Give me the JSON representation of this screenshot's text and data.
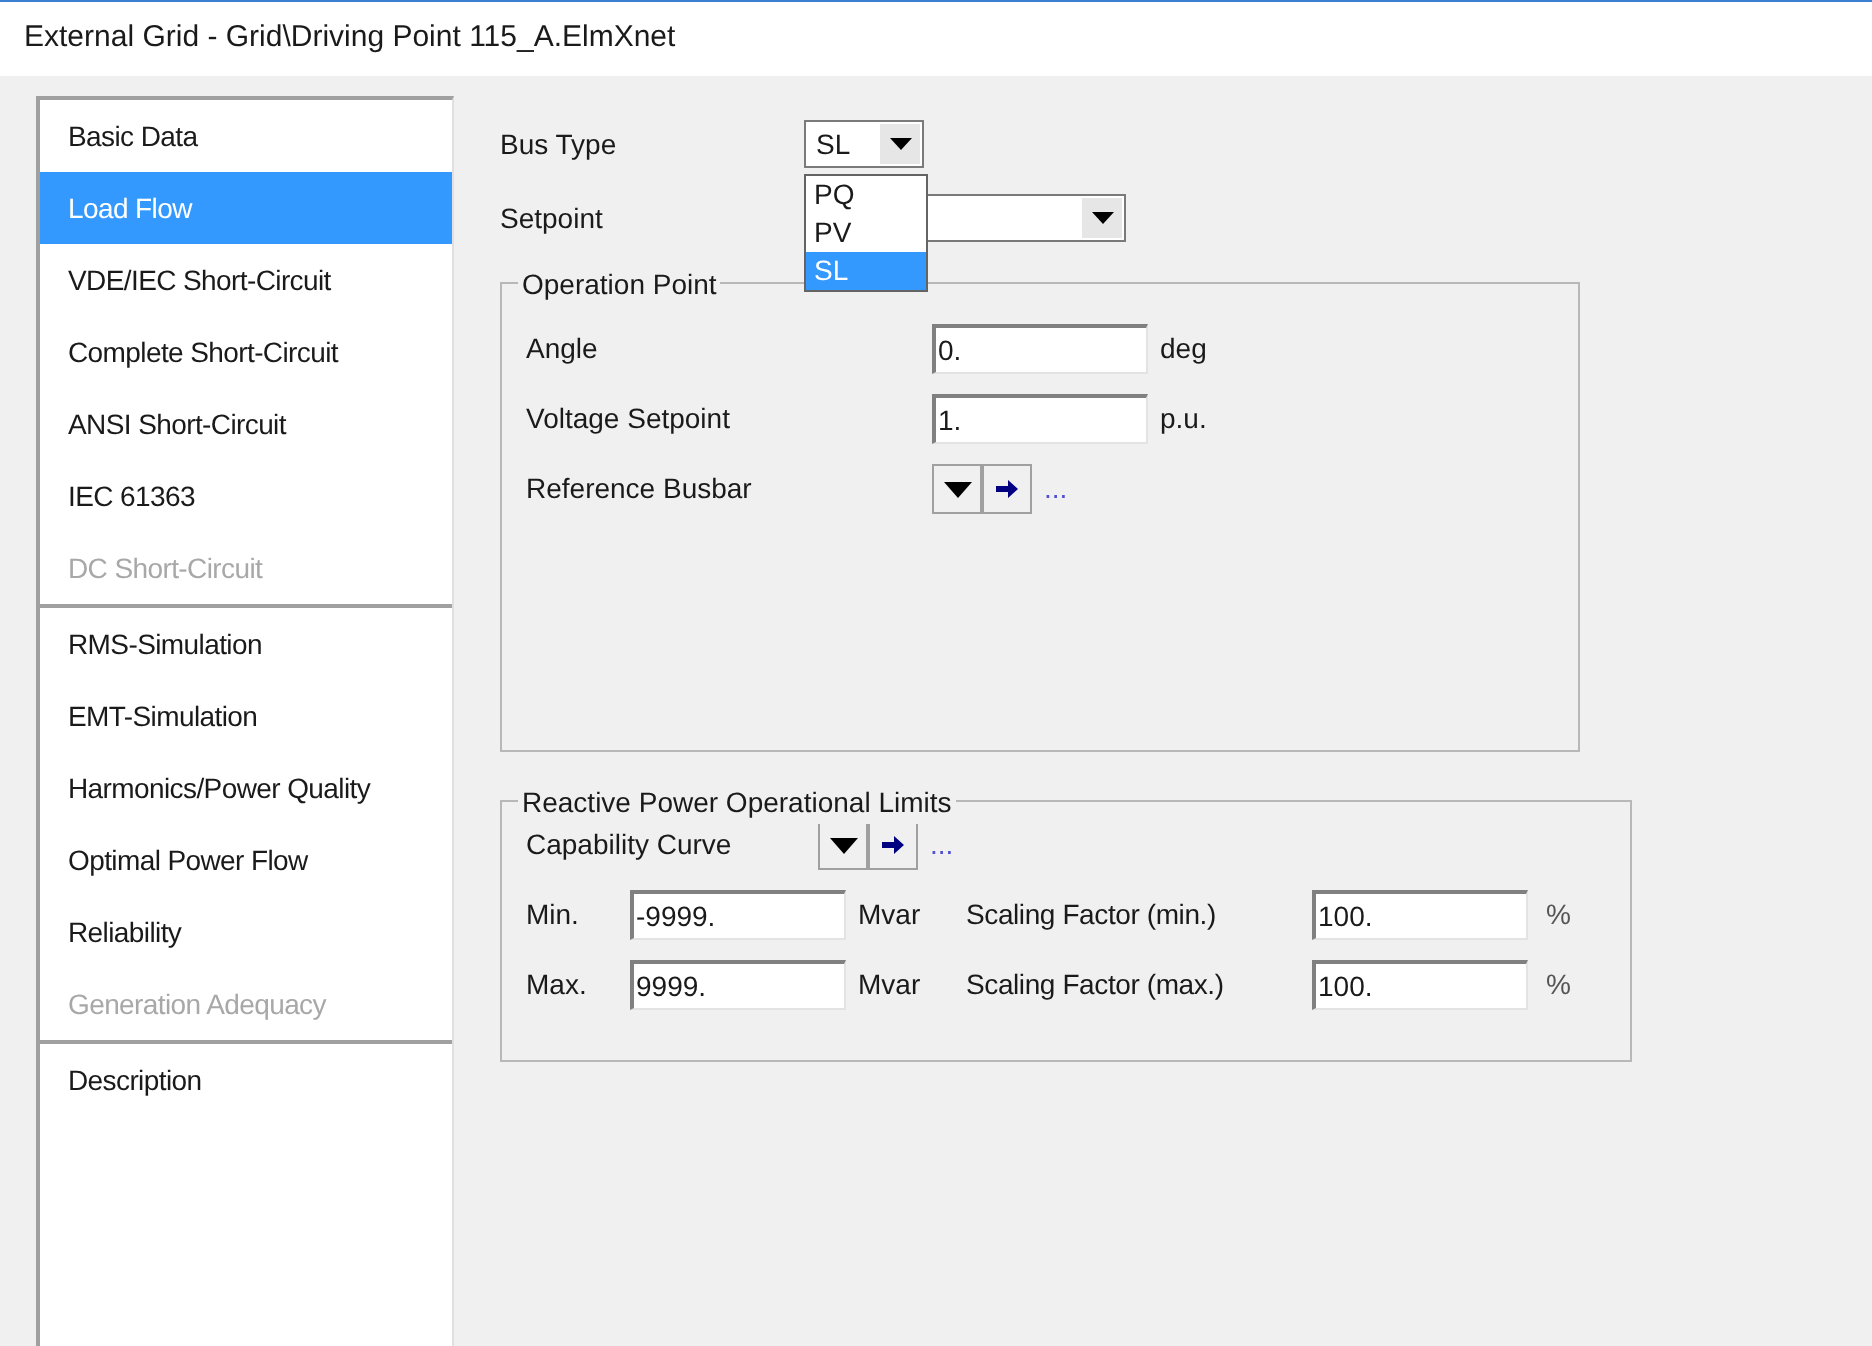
{
  "window": {
    "title": "External Grid - Grid\\Driving Point 115_A.ElmXnet"
  },
  "sidebar": {
    "groups": [
      {
        "items": [
          {
            "label": "Basic Data",
            "selected": false,
            "disabled": false
          },
          {
            "label": "Load Flow",
            "selected": true,
            "disabled": false
          },
          {
            "label": "VDE/IEC Short-Circuit",
            "selected": false,
            "disabled": false
          },
          {
            "label": "Complete Short-Circuit",
            "selected": false,
            "disabled": false
          },
          {
            "label": "ANSI Short-Circuit",
            "selected": false,
            "disabled": false
          },
          {
            "label": "IEC 61363",
            "selected": false,
            "disabled": false
          },
          {
            "label": "DC Short-Circuit",
            "selected": false,
            "disabled": true
          }
        ]
      },
      {
        "items": [
          {
            "label": "RMS-Simulation",
            "selected": false,
            "disabled": false
          },
          {
            "label": "EMT-Simulation",
            "selected": false,
            "disabled": false
          },
          {
            "label": "Harmonics/Power Quality",
            "selected": false,
            "disabled": false
          },
          {
            "label": "Optimal Power Flow",
            "selected": false,
            "disabled": false
          },
          {
            "label": "Reliability",
            "selected": false,
            "disabled": false
          },
          {
            "label": "Generation Adequacy",
            "selected": false,
            "disabled": true
          }
        ]
      },
      {
        "items": [
          {
            "label": "Description",
            "selected": false,
            "disabled": false
          }
        ]
      }
    ]
  },
  "bus_type": {
    "label": "Bus Type",
    "value": "SL",
    "expanded": true,
    "options": [
      {
        "label": "PQ",
        "selected": false
      },
      {
        "label": "PV",
        "selected": false
      },
      {
        "label": "SL",
        "selected": true
      }
    ]
  },
  "setpoint": {
    "label": "Setpoint"
  },
  "operation_point": {
    "title": "Operation Point",
    "fields": [
      {
        "label": "Angle",
        "value": "0.",
        "unit": "deg"
      },
      {
        "label": "Voltage Setpoint",
        "value": "1.",
        "unit": "p.u."
      }
    ],
    "reference_busbar": {
      "label": "Reference Busbar",
      "link": "..."
    }
  },
  "reactive_power": {
    "title": "Reactive Power Operational Limits",
    "capability_curve": {
      "label": "Capability Curve",
      "link": "..."
    },
    "rows": [
      {
        "label": "Min.",
        "value": "-9999.",
        "unit": "Mvar",
        "factor_label": "Scaling Factor (min.)",
        "factor_value": "100.",
        "factor_unit": "%"
      },
      {
        "label": "Max.",
        "value": "9999.",
        "unit": "Mvar",
        "factor_label": "Scaling Factor (max.)",
        "factor_value": "100.",
        "factor_unit": "%"
      }
    ]
  }
}
